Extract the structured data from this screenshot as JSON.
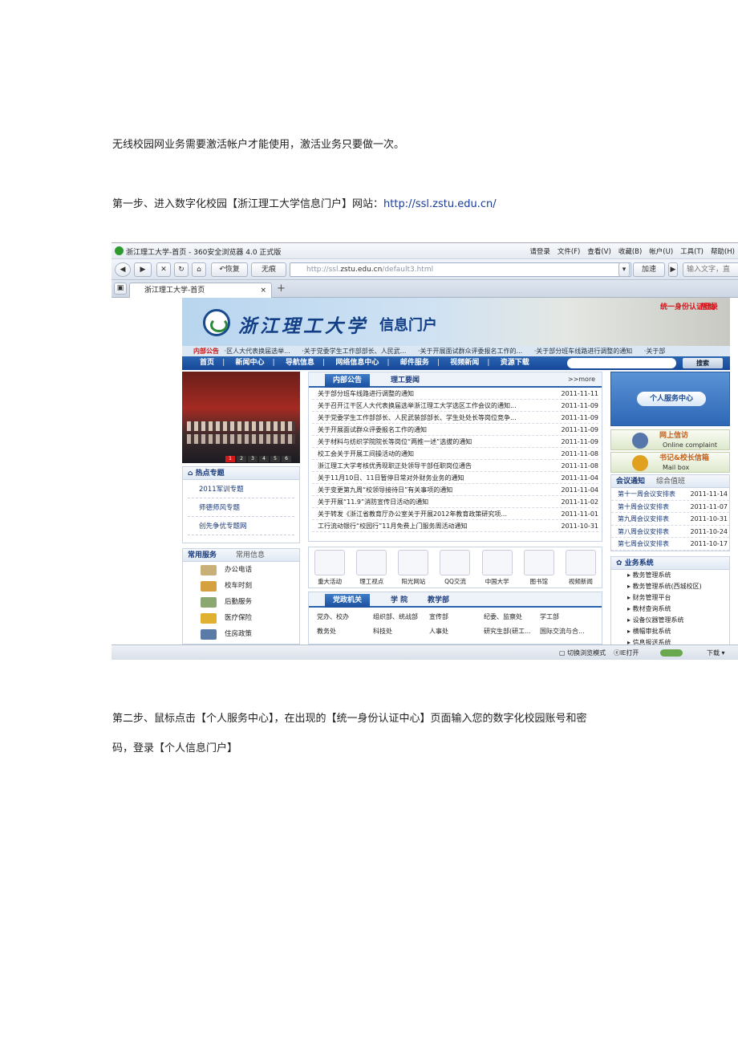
{
  "doc": {
    "p1": "无线校园网业务需要激活帐户才能使用，激活业务只要做一次。",
    "p2_prefix": "第一步、进入数字化校园【浙江理工大学信息门户】网站：",
    "p2_link": "http://ssl.zstu.edu.cn/",
    "p3_line1": "第二步、鼠标点击【个人服务中心】，在出现的【统一身份认证中心】页面输入您的数字化校园账号和密",
    "p3_line2": "码，登录【个人信息门户】"
  },
  "browser": {
    "window_title": "浙江理工大学-首页 - 360安全浏览器 4.0 正式版",
    "menu": [
      "请登录",
      "文件(F)",
      "查看(V)",
      "收藏(B)",
      "帐户(U)",
      "工具(T)",
      "帮助(H)"
    ],
    "btn_recover": "恢复",
    "btn_untitled": "无痕",
    "address_prefix": "http://ssl.",
    "address_domain": "zstu.edu.cn",
    "address_suffix": "/default3.html",
    "btn_speed": "加速",
    "search_hint": "输入文字，直",
    "tab_label": "浙江理工大学-首页",
    "tab_close": "×",
    "tab_add": "+",
    "status_mode": "切换浏览模式",
    "status_ie": "IE打开",
    "status_download": "下载"
  },
  "site": {
    "university": "浙江理工大学",
    "portal": "信息门户",
    "login": "统一身份认证登录",
    "help": "帮助",
    "announce_label": "内部公告",
    "announce_items": [
      "·区人大代表换届选举...",
      "·关于党委学生工作部部长、人民武...",
      "·关于开展面试群众评委报名工作的...",
      "·关于部分班车线路进行调整的通知",
      "·关于部"
    ],
    "nav": [
      "首页",
      "新闻中心",
      "导航信息",
      "网络信息中心",
      "邮件服务",
      "视频新闻",
      "资源下载"
    ],
    "search_btn": "搜索",
    "pager": [
      "1",
      "2",
      "3",
      "4",
      "5",
      "6"
    ],
    "hot_title": "热点专题",
    "hot_items": [
      "2011军训专题",
      "师德师风专题",
      "创先争优专题网"
    ],
    "svc_tab1": "常用服务",
    "svc_tab2": "常用信息",
    "services": [
      "办公电话",
      "校车时刻",
      "后勤服务",
      "医疗保险",
      "住房政策"
    ],
    "news_tab1": "内部公告",
    "news_tab2": "理工要闻",
    "news_more": ">>more",
    "news": [
      {
        "t": "关于部分班车线路进行调整的通知",
        "d": "2011-11-11"
      },
      {
        "t": "关于召开江干区人大代表换届选举浙江理工大学选区工作会议的通知...",
        "d": "2011-11-09"
      },
      {
        "t": "关于党委学生工作部部长、人民武装部部长、学生处处长等岗位竞争...",
        "d": "2011-11-09"
      },
      {
        "t": "关于开展面试群众评委报名工作的通知",
        "d": "2011-11-09"
      },
      {
        "t": "关于材料与纺织学院院长等岗位“两推一述”选拔的通知",
        "d": "2011-11-09"
      },
      {
        "t": "校工会关于开展工间操活动的通知",
        "d": "2011-11-08"
      },
      {
        "t": "浙江理工大学考核优秀现职正处领导干部任职岗位通告",
        "d": "2011-11-08"
      },
      {
        "t": "关于11月10日、11日暂停日常对外财务业务的通知",
        "d": "2011-11-04"
      },
      {
        "t": "关于变更第九周“校领导接待日”有关事项的通知",
        "d": "2011-11-04"
      },
      {
        "t": "关于开展“11.9”消防宣传日活动的通知",
        "d": "2011-11-02"
      },
      {
        "t": "关于转发《浙江省教育厅办公室关于开展2012年教育政策研究项...",
        "d": "2011-11-01"
      },
      {
        "t": "工行流动银行“校园行”11月免费上门服务周活动通知",
        "d": "2011-10-31"
      }
    ],
    "quick_icons": [
      "重大活动",
      "理工视点",
      "阳光网站",
      "QQ交流",
      "中国大学",
      "图书馆",
      "视频新闻"
    ],
    "dept_tab1": "党政机关",
    "dept_tab2": "学 院",
    "dept_tab3": "教学部",
    "depts": [
      "党办、校办",
      "组织部、统战部",
      "宣传部",
      "纪委、监察处",
      "学工部",
      "教务处",
      "科技处",
      "人事处",
      "研究生部(研工...",
      "国际交流与合..."
    ],
    "btn_service_center": "个人服务中心",
    "btn_complaint": "网上信访",
    "btn_complaint_en": "Online complaint",
    "btn_mailbox": "书记&校长信箱",
    "btn_mailbox_en": "Mail box",
    "meeting_tab1": "会议通知",
    "meeting_tab2": "综合值班",
    "meetings": [
      {
        "t": "第十一周会议安排表",
        "d": "2011-11-14"
      },
      {
        "t": "第十周会议安排表",
        "d": "2011-11-07"
      },
      {
        "t": "第九周会议安排表",
        "d": "2011-10-31"
      },
      {
        "t": "第八周会议安排表",
        "d": "2011-10-24"
      },
      {
        "t": "第七周会议安排表",
        "d": "2011-10-17"
      }
    ],
    "biz_title": "业务系统",
    "biz": [
      "教务管理系统",
      "教务管理系统(西城校区)",
      "财务管理平台",
      "教材查询系统",
      "设备仪器管理系统",
      "横幅审批系统",
      "信息报送系统"
    ]
  }
}
